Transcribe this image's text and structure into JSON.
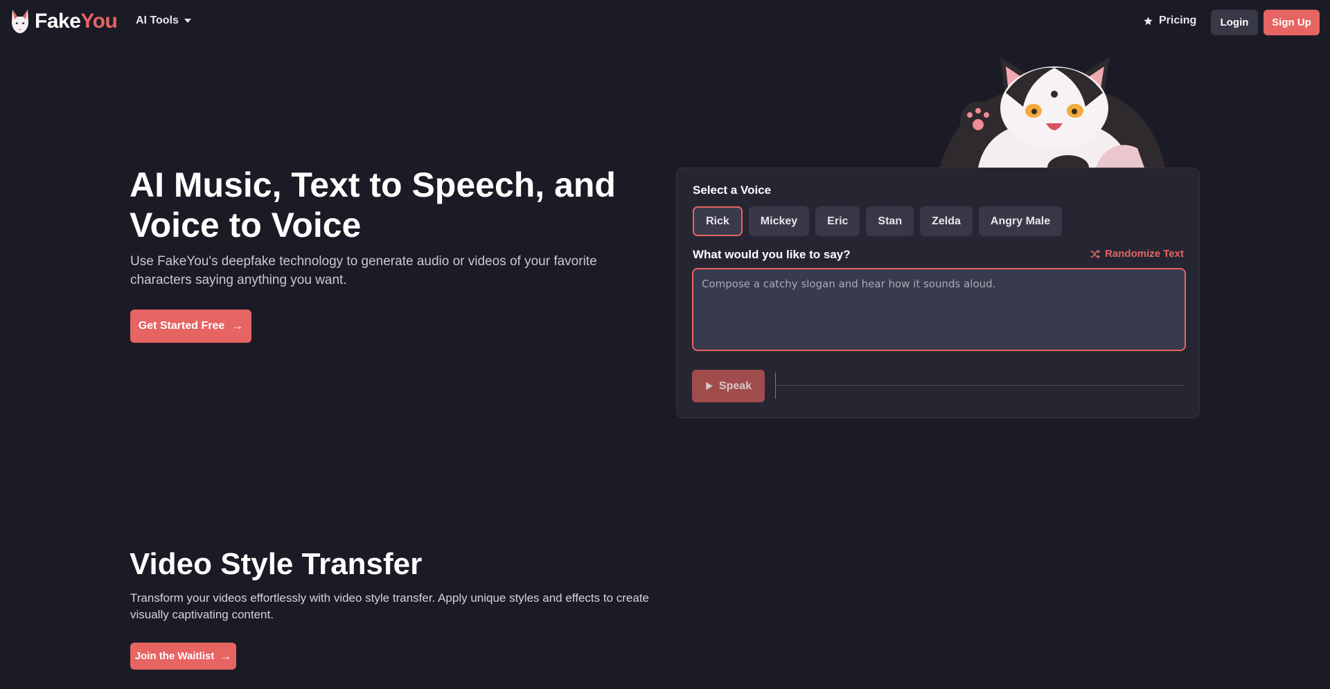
{
  "nav": {
    "logo_part1": "Fake",
    "logo_part2": "You",
    "ai_tools_label": "AI Tools",
    "pricing_label": "Pricing",
    "login_label": "Login",
    "signup_label": "Sign Up"
  },
  "hero": {
    "title": "AI Music, Text to Speech, and Voice to Voice",
    "subtitle": "Use FakeYou's deepfake technology to generate audio or videos of your favorite characters saying anything you want.",
    "cta_label": "Get Started Free"
  },
  "tts_card": {
    "select_voice_label": "Select a Voice",
    "voices": [
      "Rick",
      "Mickey",
      "Eric",
      "Stan",
      "Zelda",
      "Angry Male"
    ],
    "selected_voice": "Rick",
    "prompt_label": "What would you like to say?",
    "randomize_label": "Randomize Text",
    "text_placeholder": "Compose a catchy slogan and hear how it sounds aloud.",
    "speak_label": "Speak"
  },
  "video_section": {
    "title": "Video Style Transfer",
    "subtitle": "Transform your videos effortlessly with video style transfer. Apply unique styles and effects to create visually captivating content.",
    "cta_label": "Join the Waitlist"
  },
  "colors": {
    "accent": "#e66462",
    "background": "#1b1b26",
    "card": "#262633",
    "chip": "#383847"
  }
}
